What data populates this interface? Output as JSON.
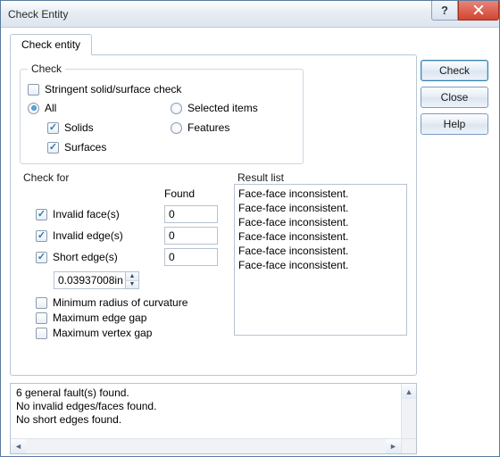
{
  "title": "Check Entity",
  "buttons": {
    "check": "Check",
    "close": "Close",
    "help": "Help"
  },
  "tab": "Check entity",
  "check_group": {
    "legend": "Check",
    "stringent": "Stringent solid/surface check",
    "all": "All",
    "selected": "Selected items",
    "solids": "Solids",
    "features": "Features",
    "surfaces": "Surfaces"
  },
  "check_for": {
    "legend": "Check for",
    "found_hdr": "Found",
    "invalid_face": "Invalid face(s)",
    "invalid_edge": "Invalid edge(s)",
    "short_edge": "Short edge(s)",
    "vals": {
      "invalid_face": "0",
      "invalid_edge": "0",
      "short_edge": "0"
    },
    "tol": "0.03937008in",
    "min_radius": "Minimum radius of curvature",
    "max_edge_gap": "Maximum edge gap",
    "max_vertex_gap": "Maximum vertex gap"
  },
  "result_list": {
    "legend": "Result list",
    "items": {
      "0": "Face-face inconsistent.",
      "1": "Face-face inconsistent.",
      "2": "Face-face inconsistent.",
      "3": "Face-face inconsistent.",
      "4": "Face-face inconsistent.",
      "5": "Face-face inconsistent."
    }
  },
  "messages": {
    "0": "6 general fault(s) found.",
    "1": "No invalid edges/faces found.",
    "2": "No short edges found."
  }
}
